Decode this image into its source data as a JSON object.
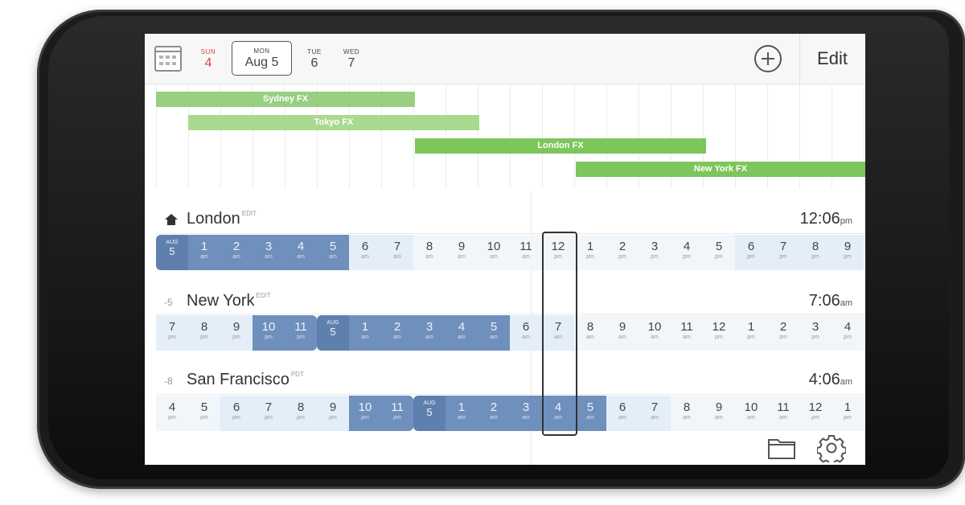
{
  "header": {
    "days": [
      {
        "name": "SUN",
        "date": "4"
      },
      {
        "name": "MON",
        "date": "Aug 5"
      },
      {
        "name": "TUE",
        "date": "6"
      },
      {
        "name": "WED",
        "date": "7"
      }
    ],
    "edit_label": "Edit"
  },
  "markets": [
    {
      "name": "Sydney FX",
      "color": "#98cf80"
    },
    {
      "name": "Tokyo FX",
      "color": "#a9d98f"
    },
    {
      "name": "London FX",
      "color": "#7cc65c"
    },
    {
      "name": "New York FX",
      "color": "#7cc65c"
    }
  ],
  "cities": [
    {
      "name": "London",
      "tag": "EDIT",
      "offset": "",
      "time": "12:06",
      "ampm": "pm",
      "cells": [
        {
          "h": "AUG",
          "a": "5",
          "t": "dayhead"
        },
        {
          "h": "1",
          "a": "am",
          "t": "night"
        },
        {
          "h": "2",
          "a": "am",
          "t": "night"
        },
        {
          "h": "3",
          "a": "am",
          "t": "night"
        },
        {
          "h": "4",
          "a": "am",
          "t": "night"
        },
        {
          "h": "5",
          "a": "am",
          "t": "night"
        },
        {
          "h": "6",
          "a": "am",
          "t": "eve"
        },
        {
          "h": "7",
          "a": "am",
          "t": "eve"
        },
        {
          "h": "8",
          "a": "am",
          "t": "day"
        },
        {
          "h": "9",
          "a": "am",
          "t": "day"
        },
        {
          "h": "10",
          "a": "am",
          "t": "day"
        },
        {
          "h": "11",
          "a": "am",
          "t": "day"
        },
        {
          "h": "12",
          "a": "pm",
          "t": "day"
        },
        {
          "h": "1",
          "a": "pm",
          "t": "day"
        },
        {
          "h": "2",
          "a": "pm",
          "t": "day"
        },
        {
          "h": "3",
          "a": "pm",
          "t": "day"
        },
        {
          "h": "4",
          "a": "pm",
          "t": "day"
        },
        {
          "h": "5",
          "a": "pm",
          "t": "day"
        },
        {
          "h": "6",
          "a": "pm",
          "t": "eve"
        },
        {
          "h": "7",
          "a": "pm",
          "t": "eve"
        },
        {
          "h": "8",
          "a": "pm",
          "t": "eve"
        },
        {
          "h": "9",
          "a": "pm",
          "t": "eve"
        }
      ]
    },
    {
      "name": "New York",
      "tag": "EDIT",
      "offset": "-5",
      "time": "7:06",
      "ampm": "am",
      "cells": [
        {
          "h": "7",
          "a": "pm",
          "t": "eve"
        },
        {
          "h": "8",
          "a": "pm",
          "t": "eve"
        },
        {
          "h": "9",
          "a": "pm",
          "t": "eve"
        },
        {
          "h": "10",
          "a": "pm",
          "t": "night"
        },
        {
          "h": "11",
          "a": "pm",
          "t": "nightend"
        },
        {
          "h": "AUG",
          "a": "5",
          "t": "dayhead"
        },
        {
          "h": "1",
          "a": "am",
          "t": "night"
        },
        {
          "h": "2",
          "a": "am",
          "t": "night"
        },
        {
          "h": "3",
          "a": "am",
          "t": "night"
        },
        {
          "h": "4",
          "a": "am",
          "t": "night"
        },
        {
          "h": "5",
          "a": "am",
          "t": "night"
        },
        {
          "h": "6",
          "a": "am",
          "t": "eve"
        },
        {
          "h": "7",
          "a": "am",
          "t": "eve"
        },
        {
          "h": "8",
          "a": "am",
          "t": "day"
        },
        {
          "h": "9",
          "a": "am",
          "t": "day"
        },
        {
          "h": "10",
          "a": "am",
          "t": "day"
        },
        {
          "h": "11",
          "a": "am",
          "t": "day"
        },
        {
          "h": "12",
          "a": "pm",
          "t": "day"
        },
        {
          "h": "1",
          "a": "pm",
          "t": "day"
        },
        {
          "h": "2",
          "a": "pm",
          "t": "day"
        },
        {
          "h": "3",
          "a": "pm",
          "t": "day"
        },
        {
          "h": "4",
          "a": "pm",
          "t": "day"
        }
      ]
    },
    {
      "name": "San Francisco",
      "tag": "PDT",
      "offset": "-8",
      "time": "4:06",
      "ampm": "am",
      "cells": [
        {
          "h": "4",
          "a": "pm",
          "t": "day"
        },
        {
          "h": "5",
          "a": "pm",
          "t": "day"
        },
        {
          "h": "6",
          "a": "pm",
          "t": "eve"
        },
        {
          "h": "7",
          "a": "pm",
          "t": "eve"
        },
        {
          "h": "8",
          "a": "pm",
          "t": "eve"
        },
        {
          "h": "9",
          "a": "pm",
          "t": "eve"
        },
        {
          "h": "10",
          "a": "pm",
          "t": "night"
        },
        {
          "h": "11",
          "a": "pm",
          "t": "nightend"
        },
        {
          "h": "AUG",
          "a": "5",
          "t": "dayhead"
        },
        {
          "h": "1",
          "a": "am",
          "t": "night"
        },
        {
          "h": "2",
          "a": "am",
          "t": "night"
        },
        {
          "h": "3",
          "a": "am",
          "t": "night"
        },
        {
          "h": "4",
          "a": "am",
          "t": "night"
        },
        {
          "h": "5",
          "a": "am",
          "t": "night"
        },
        {
          "h": "6",
          "a": "am",
          "t": "eve"
        },
        {
          "h": "7",
          "a": "am",
          "t": "eve"
        },
        {
          "h": "8",
          "a": "am",
          "t": "day"
        },
        {
          "h": "9",
          "a": "am",
          "t": "day"
        },
        {
          "h": "10",
          "a": "am",
          "t": "day"
        },
        {
          "h": "11",
          "a": "am",
          "t": "day"
        },
        {
          "h": "12",
          "a": "pm",
          "t": "day"
        },
        {
          "h": "1",
          "a": "pm",
          "t": "day"
        }
      ]
    }
  ],
  "icons": {
    "calendar": "calendar-icon",
    "add": "plus-icon",
    "home": "home-icon",
    "folder": "folder-icon",
    "settings": "gear-icon"
  }
}
